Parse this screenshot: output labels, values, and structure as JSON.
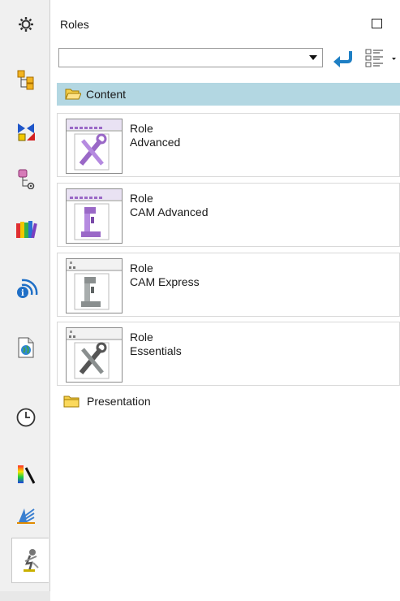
{
  "rail": {
    "icons": [
      "gear-icon",
      "assembly-navigator-icon",
      "constraint-navigator-icon",
      "part-navigator-icon",
      "reuse-library-icon",
      "hd3d-tools-icon",
      "web-browser-icon",
      "history-icon",
      "system-materials-icon",
      "process-studio-icon",
      "roles-icon"
    ]
  },
  "panel": {
    "title": "Roles",
    "combo": {
      "value": "",
      "placeholder": ""
    }
  },
  "content_folder": {
    "label": "Content"
  },
  "roles": [
    {
      "line1": "Role",
      "line2": "Advanced"
    },
    {
      "line1": "Role",
      "line2": "CAM Advanced"
    },
    {
      "line1": "Role",
      "line2": "CAM Express"
    },
    {
      "line1": "Role",
      "line2": "Essentials"
    }
  ],
  "presentation_folder": {
    "label": "Presentation"
  },
  "colors": {
    "folder_header_bg": "#b3d7e2",
    "folder_yellow": "#f4cf4a",
    "undo_blue": "#1e7fc4",
    "role_purple": "#9a68c7"
  }
}
